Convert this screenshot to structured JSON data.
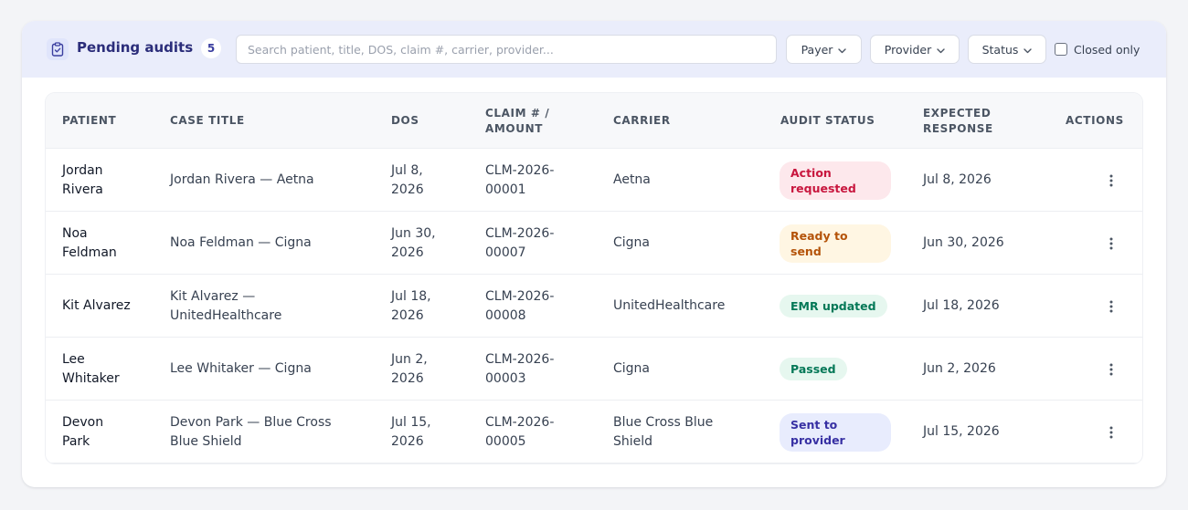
{
  "header": {
    "title": "Pending audits",
    "count": "5",
    "search_placeholder": "Search patient, title, DOS, claim #, carrier, provider...",
    "filters": {
      "payer_label": "Payer",
      "provider_label": "Provider",
      "status_label": "Status"
    },
    "closed_only_label": "Closed only"
  },
  "table": {
    "columns": {
      "patient": "PATIENT",
      "case_title": "CASE TITLE",
      "dos": "DOS",
      "claim_line1": "CLAIM # /",
      "claim_line2": "AMOUNT",
      "carrier": "CARRIER",
      "audit_status": "AUDIT STATUS",
      "expected_line1": "EXPECTED",
      "expected_line2": "RESPONSE",
      "actions": "ACTIONS"
    },
    "rows": [
      {
        "patient_first": "Jordan",
        "patient_last": "Rivera",
        "case_line1": "Jordan Rivera — Aetna",
        "case_line2": "",
        "dos_line1": "Jul 8,",
        "dos_line2": "2026",
        "claim_line1": "CLM-2026-",
        "claim_line2": "00001",
        "carrier_line1": "Aetna",
        "carrier_line2": "",
        "status_line1": "Action",
        "status_line2": "requested",
        "expected": "Jul 8, 2026"
      },
      {
        "patient_first": "Noa",
        "patient_last": "Feldman",
        "case_line1": "Noa Feldman — Cigna",
        "case_line2": "",
        "dos_line1": "Jun 30,",
        "dos_line2": "2026",
        "claim_line1": "CLM-2026-",
        "claim_line2": "00007",
        "carrier_line1": "Cigna",
        "carrier_line2": "",
        "status_line1": "Ready to",
        "status_line2": "send",
        "expected": "Jun 30, 2026"
      },
      {
        "patient_first": "Kit Alvarez",
        "patient_last": "",
        "case_line1": "Kit Alvarez —",
        "case_line2": "UnitedHealthcare",
        "dos_line1": "Jul 18,",
        "dos_line2": "2026",
        "claim_line1": "CLM-2026-",
        "claim_line2": "00008",
        "carrier_line1": "UnitedHealthcare",
        "carrier_line2": "",
        "status_line1": "EMR updated",
        "status_line2": "",
        "expected": "Jul 18, 2026"
      },
      {
        "patient_first": "Lee",
        "patient_last": "Whitaker",
        "case_line1": "Lee Whitaker — Cigna",
        "case_line2": "",
        "dos_line1": "Jun 2,",
        "dos_line2": "2026",
        "claim_line1": "CLM-2026-",
        "claim_line2": "00003",
        "carrier_line1": "Cigna",
        "carrier_line2": "",
        "status_line1": "Passed",
        "status_line2": "",
        "expected": "Jun 2, 2026"
      },
      {
        "patient_first": "Devon",
        "patient_last": "Park",
        "case_line1": "Devon Park — Blue Cross",
        "case_line2": "Blue Shield",
        "dos_line1": "Jul 15,",
        "dos_line2": "2026",
        "claim_line1": "CLM-2026-",
        "claim_line2": "00005",
        "carrier_line1": "Blue Cross Blue",
        "carrier_line2": "Shield",
        "status_line1": "Sent to",
        "status_line2": "provider",
        "expected": "Jul 15, 2026"
      }
    ]
  },
  "colors": {
    "toolbar_bg": "#eaedfb",
    "title": "#2b2d7a",
    "status_action_requested_bg": "#fde8ec",
    "status_action_requested_fg": "#c8163e",
    "status_ready_bg": "#fff6e3",
    "status_ready_fg": "#b45309",
    "status_emr_bg": "#e6f7ef",
    "status_emr_fg": "#047857",
    "status_passed_bg": "#e6f7ef",
    "status_passed_fg": "#047857",
    "status_sent_bg": "#e8ecfd",
    "status_sent_fg": "#3730a3"
  },
  "icons": {
    "title_icon": "clipboard-check-icon",
    "dropdown_icon": "chevron-down-icon",
    "row_action_icon": "kebab-vertical-icon"
  }
}
